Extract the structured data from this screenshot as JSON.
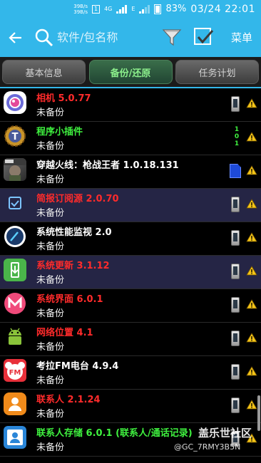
{
  "status_bar": {
    "net_up": "39B/s",
    "net_down": "39B/s",
    "sim": "1",
    "network_type": "4G",
    "signal2": "E",
    "battery": "83%",
    "time": "03/24 22:01"
  },
  "action_bar": {
    "search_placeholder": "软件/包名称",
    "menu_label": "菜单"
  },
  "tabs": [
    {
      "label": "基本信息",
      "active": false
    },
    {
      "label": "备份/还原",
      "active": true
    },
    {
      "label": "任务计划",
      "active": false
    }
  ],
  "apps": [
    {
      "name": "相机 5.0.77",
      "status": "未备份",
      "color": "red",
      "icon": "camera-app-icon",
      "storage": "phone"
    },
    {
      "name": "程序小插件",
      "status": "未备份",
      "color": "green",
      "icon": "gear-t-app-icon",
      "storage": "bits"
    },
    {
      "name": "穿越火线：枪战王者 1.0.18.131",
      "status": "未备份",
      "color": "white",
      "icon": "crossfire-game-icon",
      "storage": "sd"
    },
    {
      "name": "简报订阅源 2.0.70",
      "status": "未备份",
      "color": "red",
      "icon": "checkbox-app-icon",
      "storage": "phone",
      "highlight": true
    },
    {
      "name": "系统性能监视 2.0",
      "status": "未备份",
      "color": "white",
      "icon": "performance-monitor-icon",
      "storage": "phone"
    },
    {
      "name": "系统更新 3.1.12",
      "status": "未备份",
      "color": "red",
      "icon": "system-update-icon",
      "storage": "phone",
      "highlight": true
    },
    {
      "name": "系统界面 6.0.1",
      "status": "未备份",
      "color": "red",
      "icon": "system-ui-icon",
      "storage": "phone"
    },
    {
      "name": "网络位置 4.1",
      "status": "未备份",
      "color": "red",
      "icon": "android-icon",
      "storage": "phone"
    },
    {
      "name": "考拉FM电台 4.9.4",
      "status": "未备份",
      "color": "white",
      "icon": "koala-fm-icon",
      "storage": "phone"
    },
    {
      "name": "联系人 2.1.24",
      "status": "未备份",
      "color": "red",
      "icon": "contacts-icon",
      "storage": "phone"
    },
    {
      "name": "联系人存储 6.0.1 (联系人/通话记录)",
      "status": "未备份",
      "color": "green",
      "icon": "contacts-storage-icon",
      "storage": "phone"
    }
  ],
  "storage_bits": "1\n0\n1",
  "watermark": {
    "line1": "盖乐世社区",
    "line2": "@GC_7RMY3B5N"
  }
}
